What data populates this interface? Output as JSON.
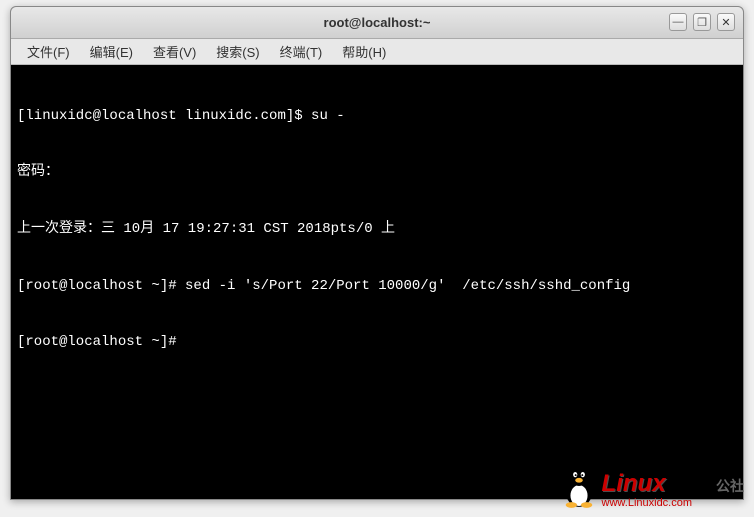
{
  "window": {
    "title": "root@localhost:~"
  },
  "menubar": {
    "items": [
      {
        "label": "文件(F)"
      },
      {
        "label": "编辑(E)"
      },
      {
        "label": "查看(V)"
      },
      {
        "label": "搜索(S)"
      },
      {
        "label": "终端(T)"
      },
      {
        "label": "帮助(H)"
      }
    ]
  },
  "terminal": {
    "lines": [
      "[linuxidc@localhost linuxidc.com]$ su -",
      "密码：",
      "上一次登录：三 10月 17 19:27:31 CST 2018pts/0 上",
      "[root@localhost ~]# sed -i 's/Port 22/Port 10000/g'  /etc/ssh/sshd_config",
      "[root@localhost ~]# "
    ]
  },
  "window_controls": {
    "minimize": "—",
    "maximize": "❐",
    "close": "✕"
  },
  "watermark": {
    "main": "Linux",
    "sub": "公社",
    "url": "www.Linuxidc.com"
  }
}
